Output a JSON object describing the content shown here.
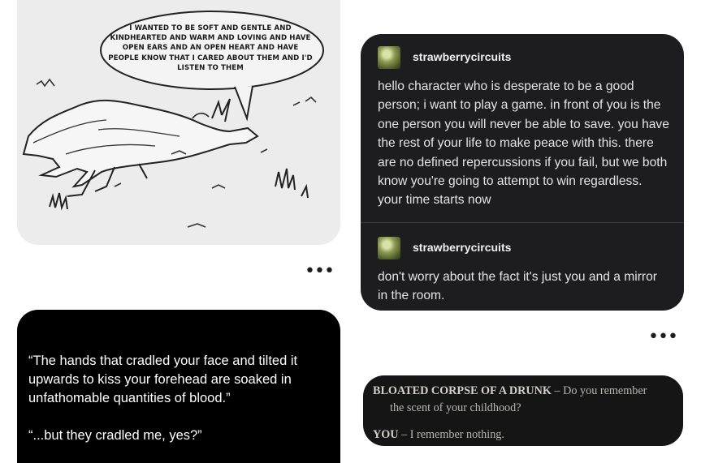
{
  "comic": {
    "speech_bubble": "I WANTED TO BE SOFT AND GENTLE AND KINDHEARTED AND WARM AND LOVING AND HAVE OPEN EARS AND AN OPEN HEART AND HAVE PEOPLE KNOW THAT I CARED ABOUT THEM AND I'D LISTEN TO THEM"
  },
  "more_icon_glyph": "•••",
  "tumblr": {
    "posts": [
      {
        "username": "strawberrycircuits",
        "body": "hello character who is desperate to be a good person; i want to play a game. in front of you is the one person you will never be able to save. you have the rest of your life to make peace with this. there are no defined repercussions if you fail, but we both know you're going to attempt to win regardless. your time starts now"
      },
      {
        "username": "strawberrycircuits",
        "body": "don't worry about the fact it's just you and a mirror in the room."
      }
    ]
  },
  "quote": {
    "line1": "“The hands that cradled your face and tilted it upwards to kiss your forehead are soaked in unfathomable quantities of blood.”",
    "line2": "“...but they cradled me, yes?”"
  },
  "dialogue": {
    "speaker1": "BLOATED CORPSE OF A DRUNK",
    "separator": "–",
    "text1a": "Do you remember",
    "text1b": "the scent of your childhood?",
    "speaker2": "YOU",
    "text2": "I remember nothing."
  },
  "colors": {
    "tumblr_card": "#1d1d1f",
    "comic_bg": "#ececec",
    "quote_card": "#000000",
    "dialogue_card": "#151515"
  }
}
